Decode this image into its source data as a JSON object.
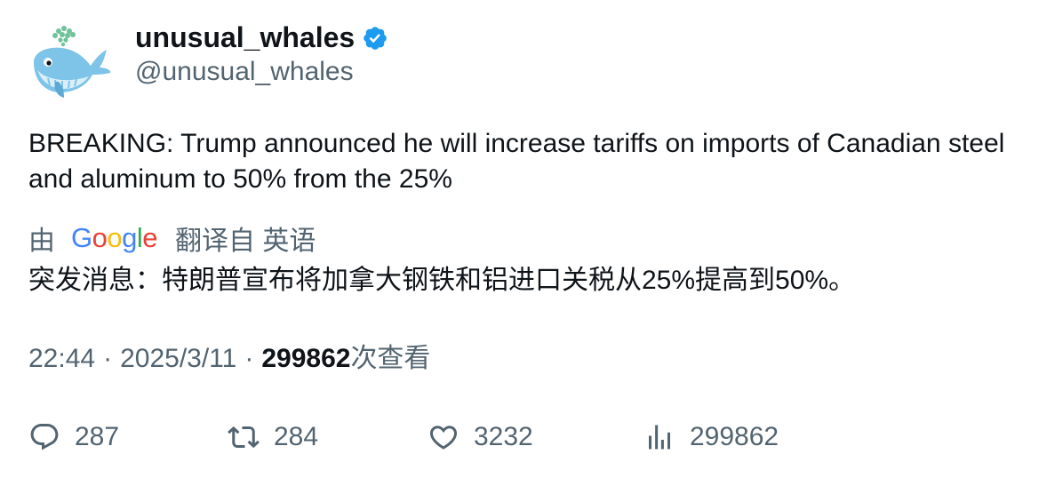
{
  "author": {
    "display_name": "unusual_whales",
    "handle": "@unusual_whales",
    "verified": true,
    "avatar_icon": "whale-icon"
  },
  "tweet": {
    "text": "BREAKING: Trump announced he will increase tariffs on imports of Canadian steel and aluminum to 50% from the 25%",
    "translation": {
      "by_label": "由",
      "provider": "Google",
      "from_label": "翻译自 英语",
      "text": "突发消息：特朗普宣布将加拿大钢铁和铝进口关税从25%提高到50%。"
    },
    "time": "22:44",
    "separator": "·",
    "date": "2025/3/11",
    "views_count": "299862",
    "views_label": "次查看"
  },
  "actions": {
    "replies": "287",
    "retweets": "284",
    "likes": "3232",
    "views": "299862"
  },
  "colors": {
    "text_primary": "#0f1419",
    "text_secondary": "#536471",
    "verified_badge": "#1d9bf0"
  }
}
